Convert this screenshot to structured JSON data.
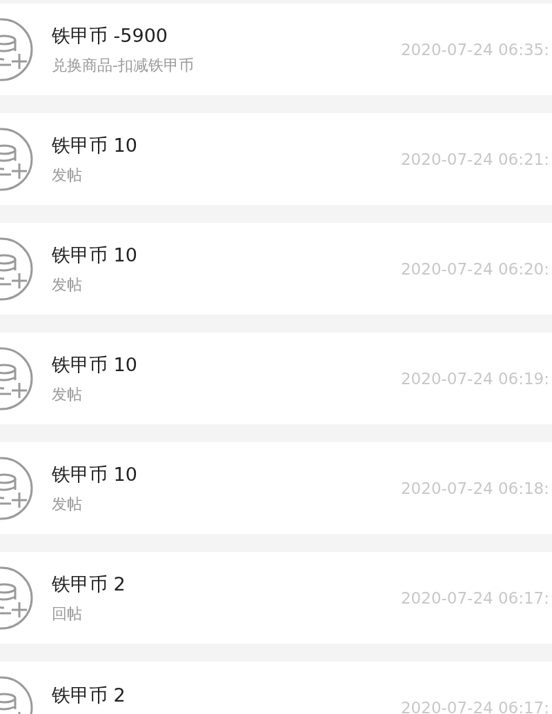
{
  "records": [
    {
      "title": "铁甲币 -5900",
      "description": "兑换商品-扣减铁甲币",
      "time": "2020-07-24 06:35:"
    },
    {
      "title": "铁甲币 10",
      "description": "发帖",
      "time": "2020-07-24 06:21:"
    },
    {
      "title": "铁甲币 10",
      "description": "发帖",
      "time": "2020-07-24 06:20:"
    },
    {
      "title": "铁甲币 10",
      "description": "发帖",
      "time": "2020-07-24 06:19:"
    },
    {
      "title": "铁甲币 10",
      "description": "发帖",
      "time": "2020-07-24 06:18:"
    },
    {
      "title": "铁甲币 2",
      "description": "回帖",
      "time": "2020-07-24 06:17:"
    },
    {
      "title": "铁甲币 2",
      "time": "2020-07-24 06:17:"
    }
  ]
}
